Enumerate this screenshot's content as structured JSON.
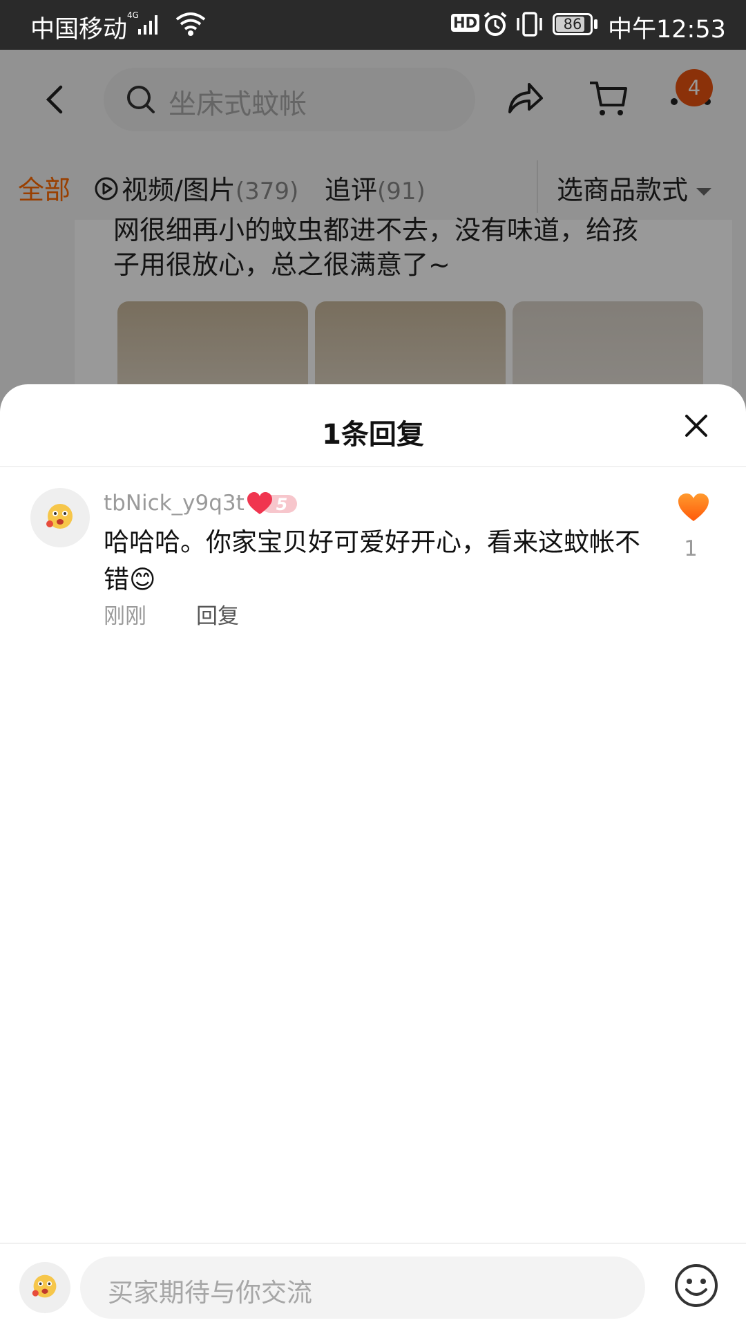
{
  "status_bar": {
    "carrier": "中国移动",
    "network": "4G",
    "hd": "HD",
    "battery": "86",
    "time": "中午12:53"
  },
  "header": {
    "search_text": "坐床式蚊帐",
    "cart_badge": "4"
  },
  "filter_tabs": {
    "all": "全部",
    "video_label": "视频/图片",
    "video_count": "(379)",
    "followup_label": "追评",
    "followup_count": "(91)",
    "select_style": "选商品款式"
  },
  "background_review": {
    "line1": "网很细再小的蚊虫都进不去，没有味道，给孩",
    "line2": "子用很放心，总之很满意了~"
  },
  "sheet": {
    "title": "1条回复"
  },
  "comment": {
    "username": "tbNick_y9q3t",
    "level": "5",
    "text": "哈哈哈。你家宝贝好可爱好开心，看来这蚊帐不错😊",
    "time": "刚刚",
    "reply": "回复",
    "likes": "1"
  },
  "input": {
    "placeholder": "买家期待与你交流"
  },
  "colors": {
    "accent": "#ff6a00",
    "badge": "#e8520f",
    "like": "#ff7a1a"
  }
}
